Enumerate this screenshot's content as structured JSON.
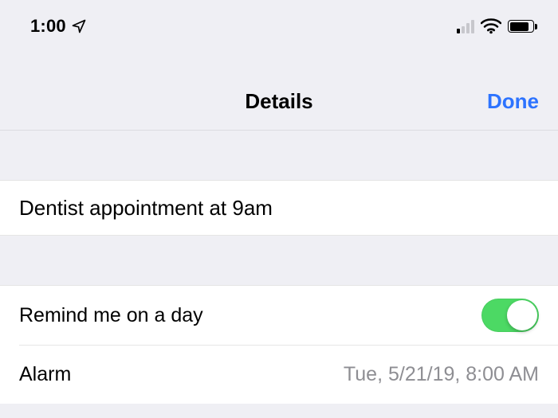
{
  "status": {
    "time": "1:00",
    "location_icon": "location-arrow",
    "signal_active_bars": 1,
    "wifi_strength": 3,
    "battery_pct": 85
  },
  "nav": {
    "title": "Details",
    "done_label": "Done"
  },
  "reminder": {
    "title": "Dentist appointment at 9am"
  },
  "rows": {
    "remind_day": {
      "label": "Remind me on a day",
      "on": true
    },
    "alarm": {
      "label": "Alarm",
      "value": "Tue, 5/21/19, 8:00 AM"
    }
  },
  "colors": {
    "accent": "#2d73ff",
    "switch_on": "#4cd964",
    "background": "#efeff4",
    "secondary_text": "#8e8e93"
  }
}
